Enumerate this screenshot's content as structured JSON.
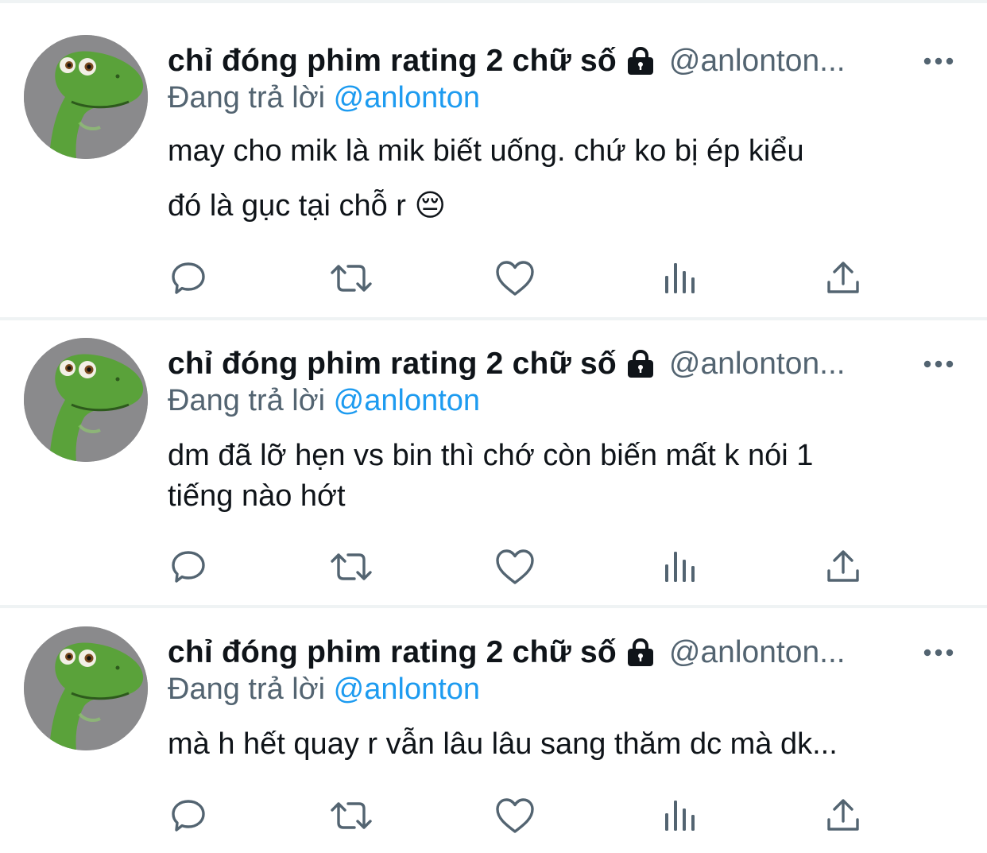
{
  "tweets": [
    {
      "display_name": "chỉ đóng phim rating 2 chữ số",
      "handle": "@anlonton...",
      "reply_prefix": "Đang trả lời",
      "reply_mention": "@anlonton",
      "lines": [
        "may cho mik là mik biết uống. chứ ko bị ép kiểu",
        "đó là gục tại chỗ r 😔"
      ]
    },
    {
      "display_name": "chỉ đóng phim rating 2 chữ số",
      "handle": "@anlonton...",
      "reply_prefix": "Đang trả lời",
      "reply_mention": "@anlonton",
      "lines": [
        "dm đã lỡ hẹn vs bin thì chớ còn biến mất k nói 1",
        "tiếng nào hớt"
      ]
    },
    {
      "display_name": "chỉ đóng phim rating 2 chữ số",
      "handle": "@anlonton...",
      "reply_prefix": "Đang trả lời",
      "reply_mention": "@anlonton",
      "lines": [
        "mà h hết quay r vẫn lâu lâu sang thăm dc mà dk..."
      ]
    }
  ],
  "icons": {
    "avatar": "green-dinosaur-avatar",
    "lock": "lock-icon",
    "more": "more-icon",
    "actions": [
      "reply-icon",
      "retweet-icon",
      "like-icon",
      "views-icon",
      "share-icon"
    ]
  },
  "colors": {
    "text": "#0f1419",
    "secondary": "#536471",
    "link": "#1d9bf0",
    "separator": "#eff3f4",
    "avatar_bg": "#8a8a8c",
    "dino_green": "#5aa23a"
  }
}
